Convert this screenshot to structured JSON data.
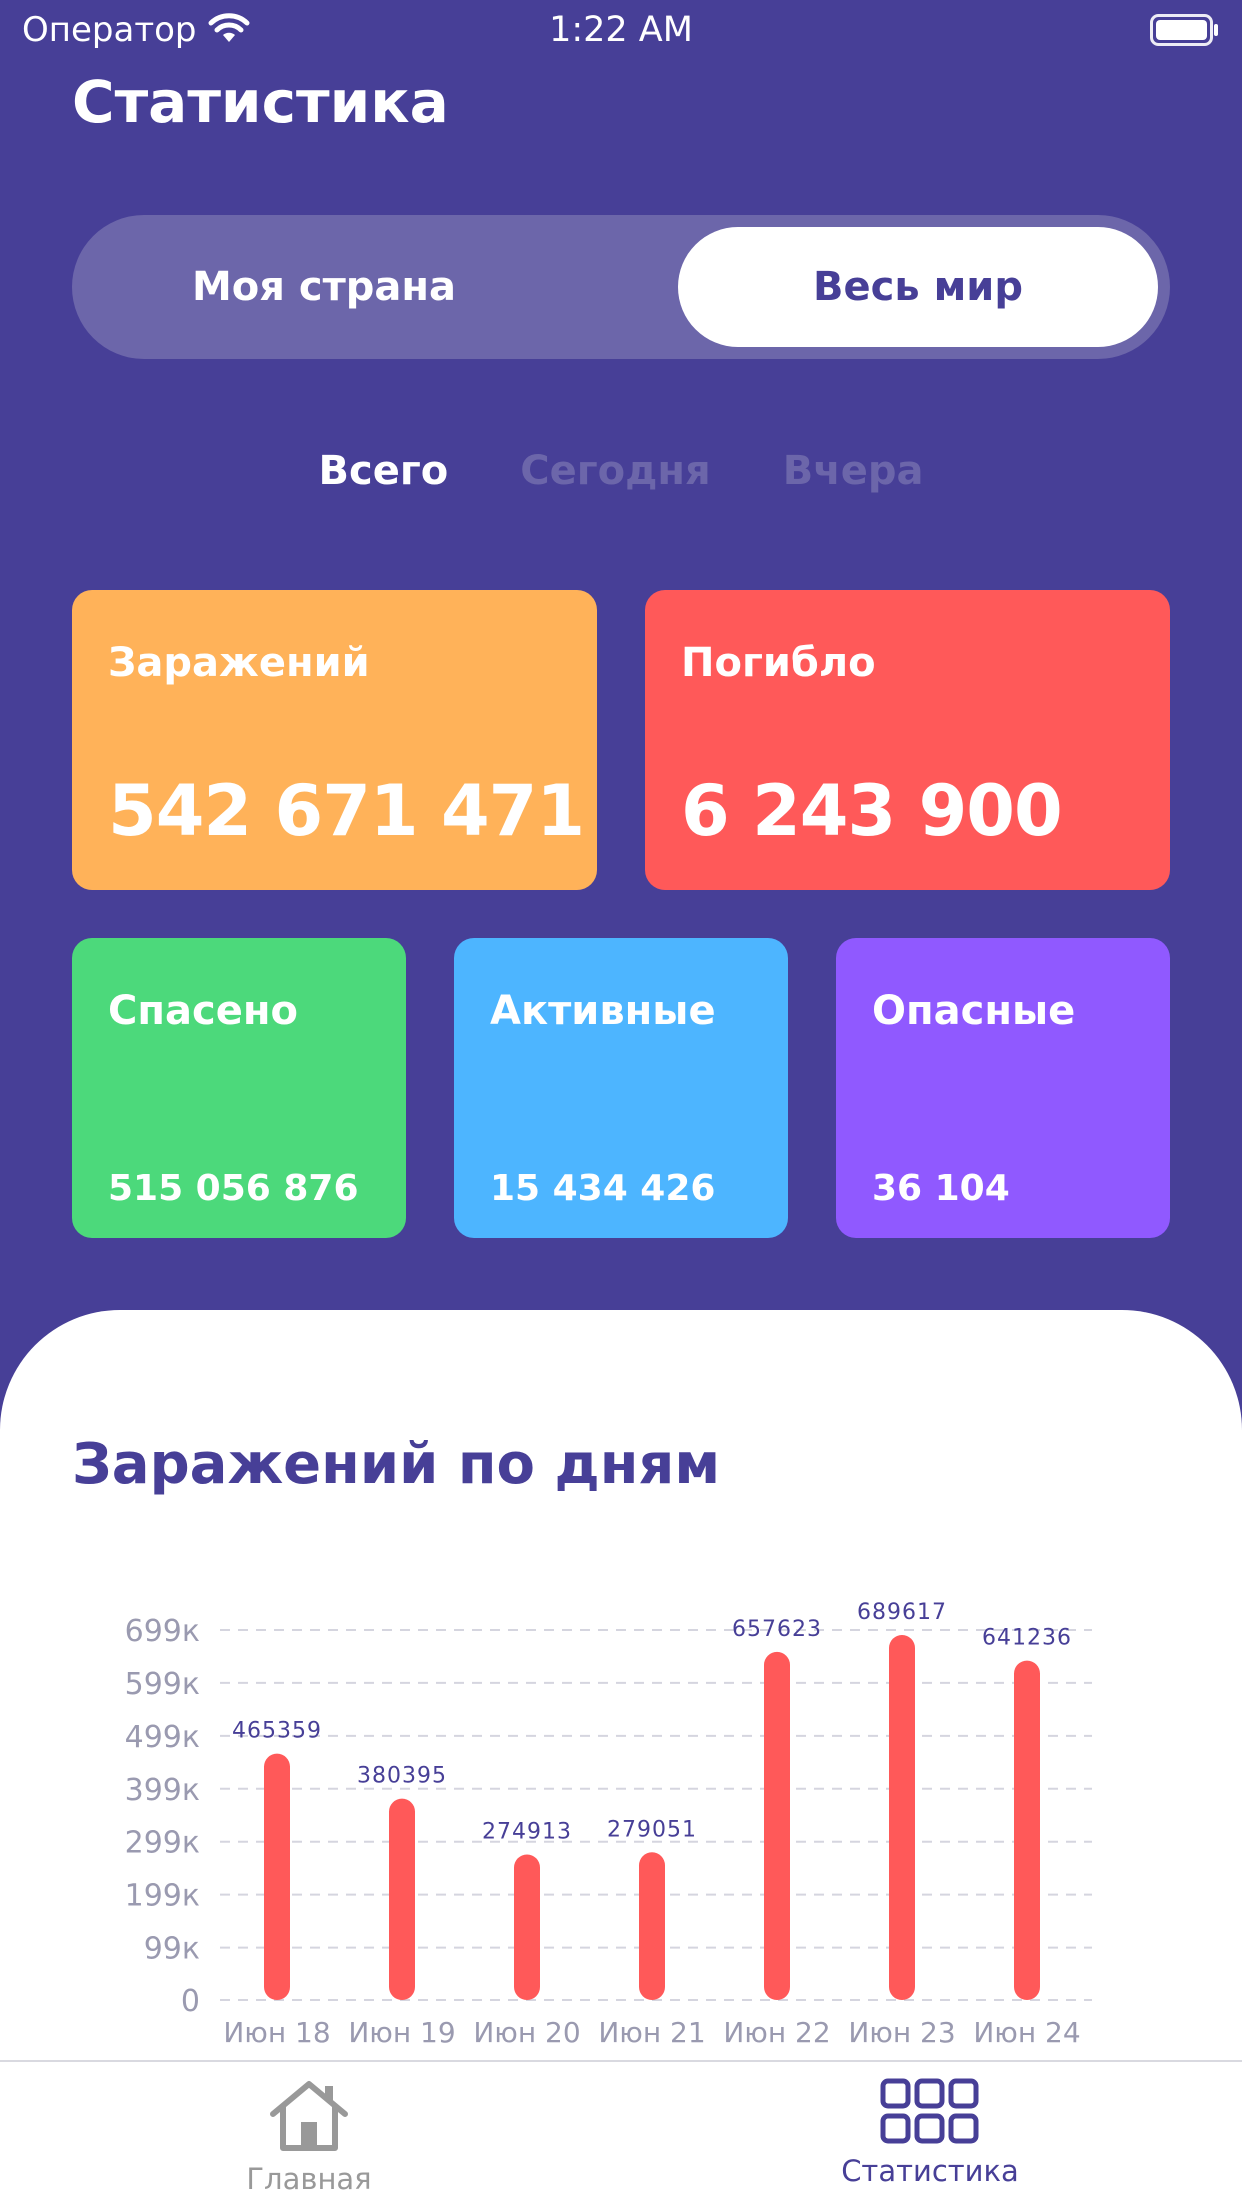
{
  "status_bar": {
    "carrier": "Оператор",
    "time": "1:22 AM"
  },
  "page_title": "Статистика",
  "segment": {
    "left_label": "Моя страна",
    "right_label": "Весь мир",
    "selected": "Весь мир"
  },
  "period_tabs": {
    "items": [
      "Всего",
      "Сегодня",
      "Вчера"
    ],
    "active": "Всего"
  },
  "cards": {
    "infected": {
      "label": "Заражений",
      "value": "542 671 471",
      "color": "#FFB259"
    },
    "deaths": {
      "label": "Погибло",
      "value": "6 243 900",
      "color": "#FF5959"
    },
    "recovered": {
      "label": "Спасено",
      "value": "515 056 876",
      "color": "#4CD97B"
    },
    "active": {
      "label": "Активные",
      "value": "15 434 426",
      "color": "#4DB5FF"
    },
    "serious": {
      "label": "Опасные",
      "value": "36 104",
      "color": "#9059FF"
    }
  },
  "chart_title": "Заражений по дням",
  "chart_data": {
    "type": "bar",
    "categories": [
      "Июн 18",
      "Июн 19",
      "Июн 20",
      "Июн 21",
      "Июн 22",
      "Июн 23",
      "Июн 24"
    ],
    "values": [
      465359,
      380395,
      274913,
      279051,
      657623,
      689617,
      641236
    ],
    "y_ticks": [
      "0",
      "99к",
      "199к",
      "299к",
      "399к",
      "499к",
      "599к",
      "699к"
    ],
    "y_tick_values": [
      0,
      99000,
      199000,
      299000,
      399000,
      499000,
      599000,
      699000
    ],
    "ylim": [
      0,
      699000
    ],
    "grid": true,
    "bar_color": "#FF5959",
    "label_color": "#473F97"
  },
  "tab_bar": {
    "items": [
      {
        "label": "Главная",
        "icon": "home-icon",
        "active": false
      },
      {
        "label": "Статистика",
        "icon": "grid-icon",
        "active": true
      }
    ]
  },
  "colors": {
    "background": "#473F97",
    "segment_bg": "#6C66AA",
    "inactive_text": "#6C66AA"
  }
}
